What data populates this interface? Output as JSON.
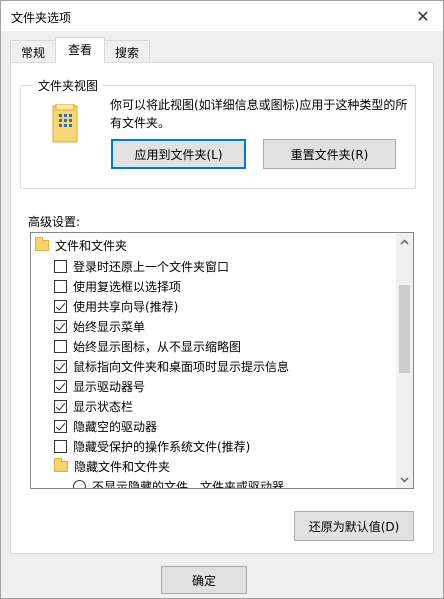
{
  "window": {
    "title": "文件夹选项",
    "close_glyph": "✕"
  },
  "tabs": [
    {
      "label": "常规"
    },
    {
      "label": "查看",
      "active": true
    },
    {
      "label": "搜索"
    }
  ],
  "folder_views": {
    "legend": "文件夹视图",
    "description": "你可以将此视图(如详细信息或图标)应用于这种类型的所有文件夹。",
    "apply_button": "应用到文件夹(L)",
    "reset_button": "重置文件夹(R)"
  },
  "advanced": {
    "label": "高级设置:",
    "items": [
      {
        "type": "folder",
        "label": "文件和文件夹",
        "indent": 0
      },
      {
        "type": "checkbox",
        "label": "登录时还原上一个文件夹窗口",
        "checked": false,
        "indent": 1
      },
      {
        "type": "checkbox",
        "label": "使用复选框以选择项",
        "checked": false,
        "indent": 1
      },
      {
        "type": "checkbox",
        "label": "使用共享向导(推荐)",
        "checked": true,
        "indent": 1
      },
      {
        "type": "checkbox",
        "label": "始终显示菜单",
        "checked": true,
        "indent": 1
      },
      {
        "type": "checkbox",
        "label": "始终显示图标，从不显示缩略图",
        "checked": false,
        "indent": 1
      },
      {
        "type": "checkbox",
        "label": "鼠标指向文件夹和桌面项时显示提示信息",
        "checked": true,
        "indent": 1
      },
      {
        "type": "checkbox",
        "label": "显示驱动器号",
        "checked": true,
        "indent": 1
      },
      {
        "type": "checkbox",
        "label": "显示状态栏",
        "checked": true,
        "indent": 1
      },
      {
        "type": "checkbox",
        "label": "隐藏空的驱动器",
        "checked": true,
        "indent": 1
      },
      {
        "type": "checkbox",
        "label": "隐藏受保护的操作系统文件(推荐)",
        "checked": false,
        "indent": 1
      },
      {
        "type": "folder",
        "label": "隐藏文件和文件夹",
        "indent": 1
      },
      {
        "type": "radio",
        "label": "不显示隐藏的文件、文件夹或驱动器",
        "checked": false,
        "indent": 2
      }
    ],
    "restore_button": "还原为默认值(D)"
  },
  "footer": {
    "ok_button": "确定"
  }
}
